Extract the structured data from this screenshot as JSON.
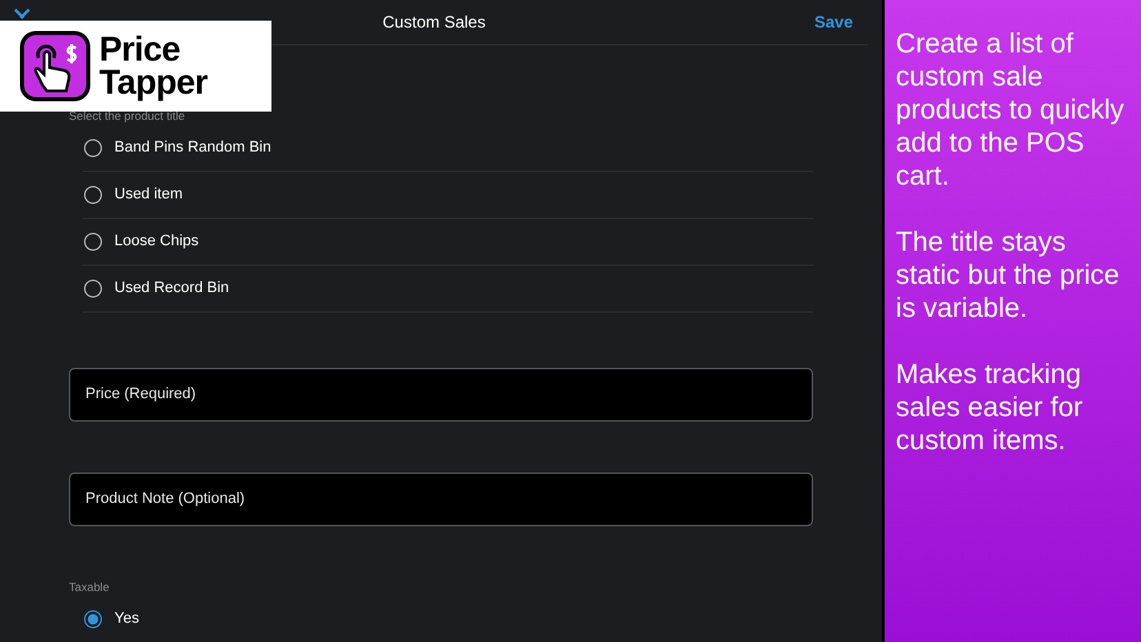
{
  "logo": {
    "line_1": "Price",
    "line_2": "Tapper"
  },
  "header": {
    "title": "Custom Sales",
    "action": "Save"
  },
  "product_title": {
    "label": "Select the product title",
    "options": [
      {
        "label": "Band Pins Random Bin",
        "selected": false
      },
      {
        "label": "Used item",
        "selected": false
      },
      {
        "label": "Loose Chips",
        "selected": false
      },
      {
        "label": "Used Record Bin",
        "selected": false
      }
    ]
  },
  "fields": [
    {
      "placeholder": "Price (Required)"
    },
    {
      "placeholder": "Product Note (Optional)"
    }
  ],
  "taxable": {
    "label": "Taxable",
    "options": [
      {
        "label": "Yes",
        "selected": true
      }
    ]
  },
  "promo": [
    "Create a list of custom sale products to quickly add to the POS cart.",
    "The title stays static but the price is variable.",
    "Makes tracking sales easier for custom items."
  ]
}
